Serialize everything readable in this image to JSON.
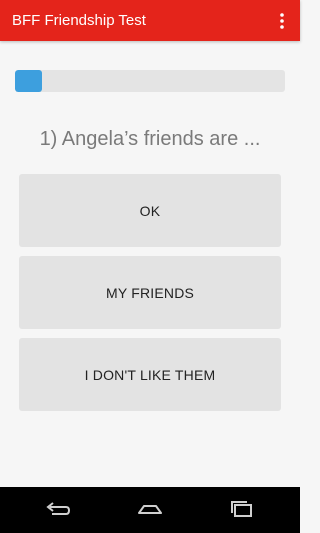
{
  "app_bar": {
    "title": "BFF Friendship Test",
    "color": "#e4241b",
    "overflow_icon": "more-vert-icon"
  },
  "progress": {
    "value": 0.1,
    "fill_color": "#3d9fde",
    "track_color": "#e4e4e4"
  },
  "question": {
    "text": "1) Angela’s friends are ..."
  },
  "answers": [
    {
      "label": "OK"
    },
    {
      "label": "MY FRIENDS"
    },
    {
      "label": "I DON'T LIKE THEM"
    }
  ],
  "nav_bar": {
    "buttons": [
      "back-icon",
      "home-icon",
      "recents-icon"
    ]
  }
}
